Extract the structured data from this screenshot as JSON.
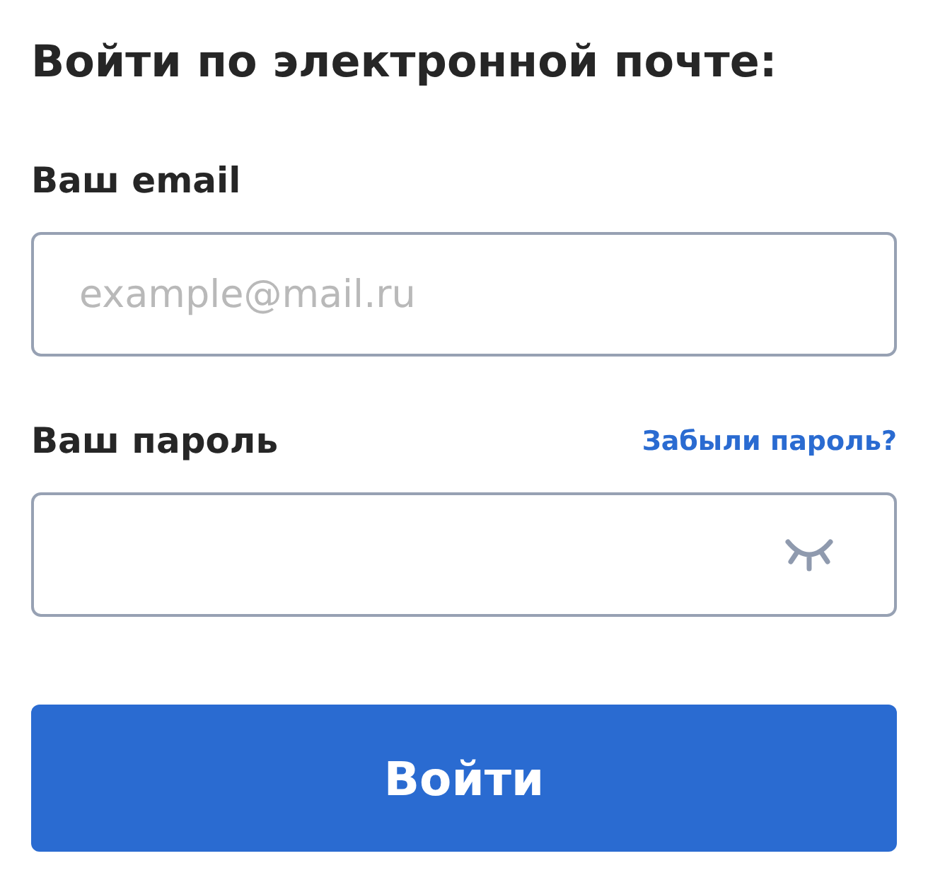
{
  "title": "Войти по электронной почте:",
  "email": {
    "label": "Ваш email",
    "placeholder": "example@mail.ru"
  },
  "password": {
    "label": "Ваш пароль",
    "forgot_link": "Забыли пароль?"
  },
  "submit": "Войти"
}
